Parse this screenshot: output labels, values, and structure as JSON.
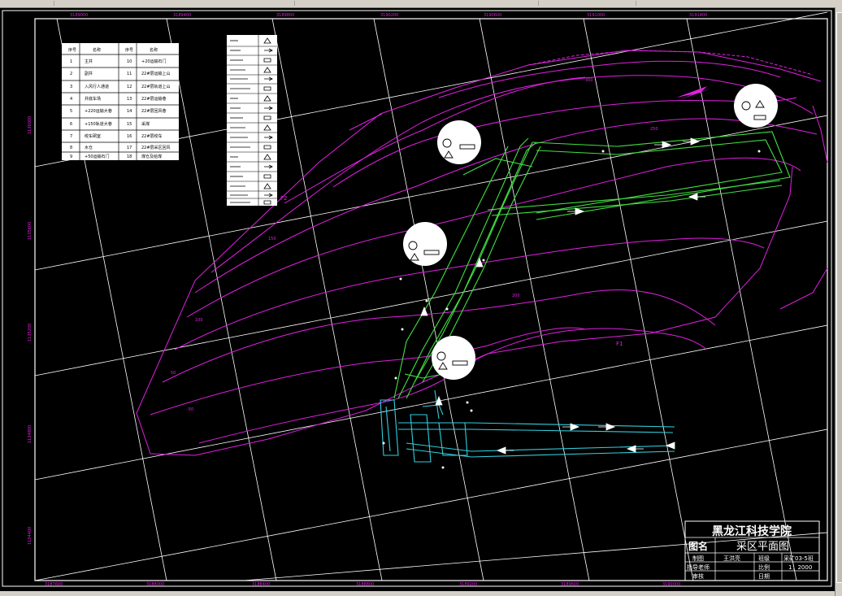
{
  "window": {
    "scrollbar": "vertical-scrollbar",
    "toolbar": "top-toolbar"
  },
  "colors": {
    "background": "#000000",
    "frame": "#ffffff",
    "contours": "#e020e0",
    "roadways_green": "#40e040",
    "roadways_cyan": "#30d0e0",
    "grid": "#ffffff"
  },
  "title_block": {
    "institution": "黑龙江科技学院",
    "label_drawing_name": "图名",
    "drawing_name": "采区平面图",
    "label_drafter": "制图",
    "drafter": "王洪亮",
    "label_class": "班级",
    "class": "采矿03-5班",
    "label_advisor": "指导老师",
    "label_scale": "比例",
    "scale": "1：2000",
    "label_review": "审核",
    "label_date": "日期"
  },
  "coordinate_labels": {
    "top": [
      "3189000",
      "3189400",
      "3189800",
      "3190200",
      "3190600",
      "3191000",
      "3191400"
    ],
    "bottom": [
      "3187600",
      "3188000",
      "3188400",
      "3188800",
      "3189200",
      "3189600",
      "3190000"
    ],
    "left": [
      "1136000",
      "1135600",
      "1135200",
      "1134800",
      "1134400"
    ]
  },
  "roadway_table": {
    "headers": [
      "序号",
      "名称",
      "序号",
      "名称"
    ],
    "rows": [
      [
        "1",
        "主井",
        "10",
        "+20运输石门"
      ],
      [
        "2",
        "副井",
        "11",
        "22#层运输上山"
      ],
      [
        "3",
        "入风行人通道",
        "12",
        "22#层轨道上山"
      ],
      [
        "4",
        "井底车场",
        "13",
        "22#层运输巷"
      ],
      [
        "5",
        "+220运输大巷",
        "14",
        "22#层回风巷"
      ],
      [
        "6",
        "+150轨道大巷",
        "15",
        "采煤"
      ],
      [
        "7",
        "绞车硐室",
        "16",
        "22#层绞车"
      ],
      [
        "8",
        "水仓",
        "17",
        "22#层采区回风"
      ],
      [
        "9",
        "+50运输石门",
        "18",
        "煤仓及给煤"
      ]
    ]
  },
  "seam_labels": [
    "F2",
    "F1"
  ],
  "contour_labels": [
    "100",
    "150",
    "200",
    "250",
    "300",
    "50",
    "-50"
  ]
}
